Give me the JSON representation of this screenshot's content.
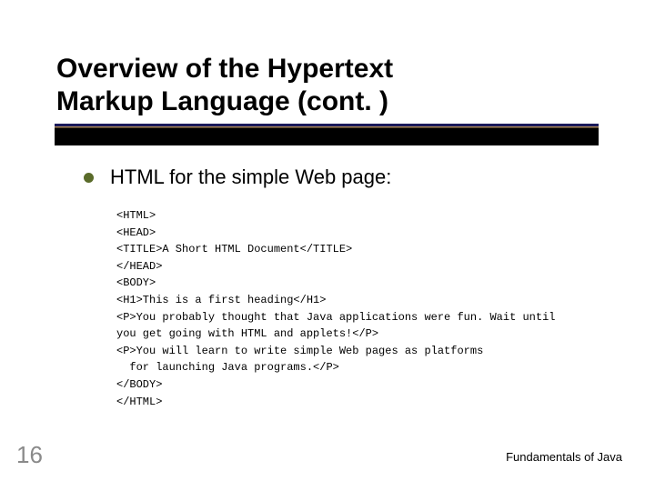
{
  "title": {
    "line1": "Overview of the Hypertext",
    "line2": "Markup Language (cont. )"
  },
  "bullet": {
    "text": "HTML for the simple Web page:"
  },
  "code": {
    "lines": [
      "<HTML>",
      "<HEAD>",
      "<TITLE>A Short HTML Document</TITLE>",
      "</HEAD>",
      "<BODY>",
      "<H1>This is a first heading</H1>",
      "<P>You probably thought that Java applications were fun. Wait until",
      "you get going with HTML and applets!</P>",
      "<P>You will learn to write simple Web pages as platforms",
      "  for launching Java programs.</P>",
      "</BODY>",
      "</HTML>"
    ]
  },
  "footer": {
    "page": "16",
    "text": "Fundamentals of Java"
  }
}
